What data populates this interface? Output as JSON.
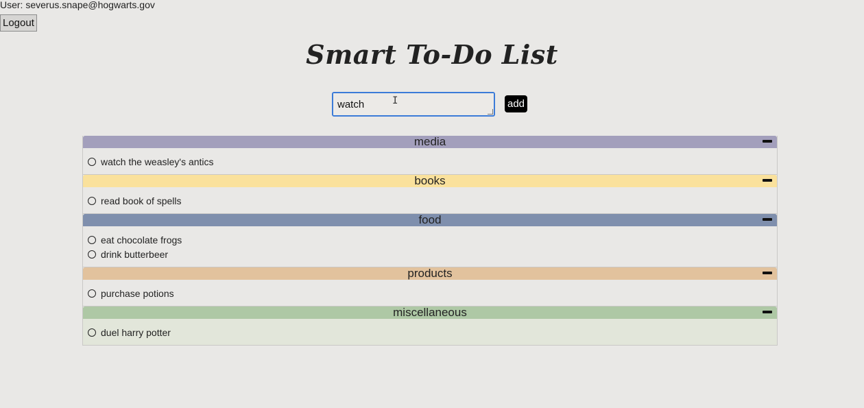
{
  "header": {
    "user_text": "User: severus.snape@hogwarts.gov",
    "logout_label": "Logout"
  },
  "title": "Smart To-Do List",
  "input": {
    "value": "watch",
    "placeholder": ""
  },
  "add_label": "add",
  "categories": [
    {
      "name": "media",
      "header_color": "#a39fbc",
      "body_color": "#e9e8e6",
      "items": [
        "watch the weasley's antics"
      ]
    },
    {
      "name": "books",
      "header_color": "#fae19c",
      "body_color": "#e9e8e6",
      "items": [
        "read book of spells"
      ]
    },
    {
      "name": "food",
      "header_color": "#7f8fad",
      "body_color": "#e9e8e6",
      "items": [
        "eat chocolate frogs",
        "drink butterbeer"
      ]
    },
    {
      "name": "products",
      "header_color": "#e2c29d",
      "body_color": "#e9e8e6",
      "items": [
        "purchase potions"
      ]
    },
    {
      "name": "miscellaneous",
      "header_color": "#aec8a5",
      "body_color": "#e2e6da",
      "items": [
        "duel harry potter"
      ]
    }
  ]
}
